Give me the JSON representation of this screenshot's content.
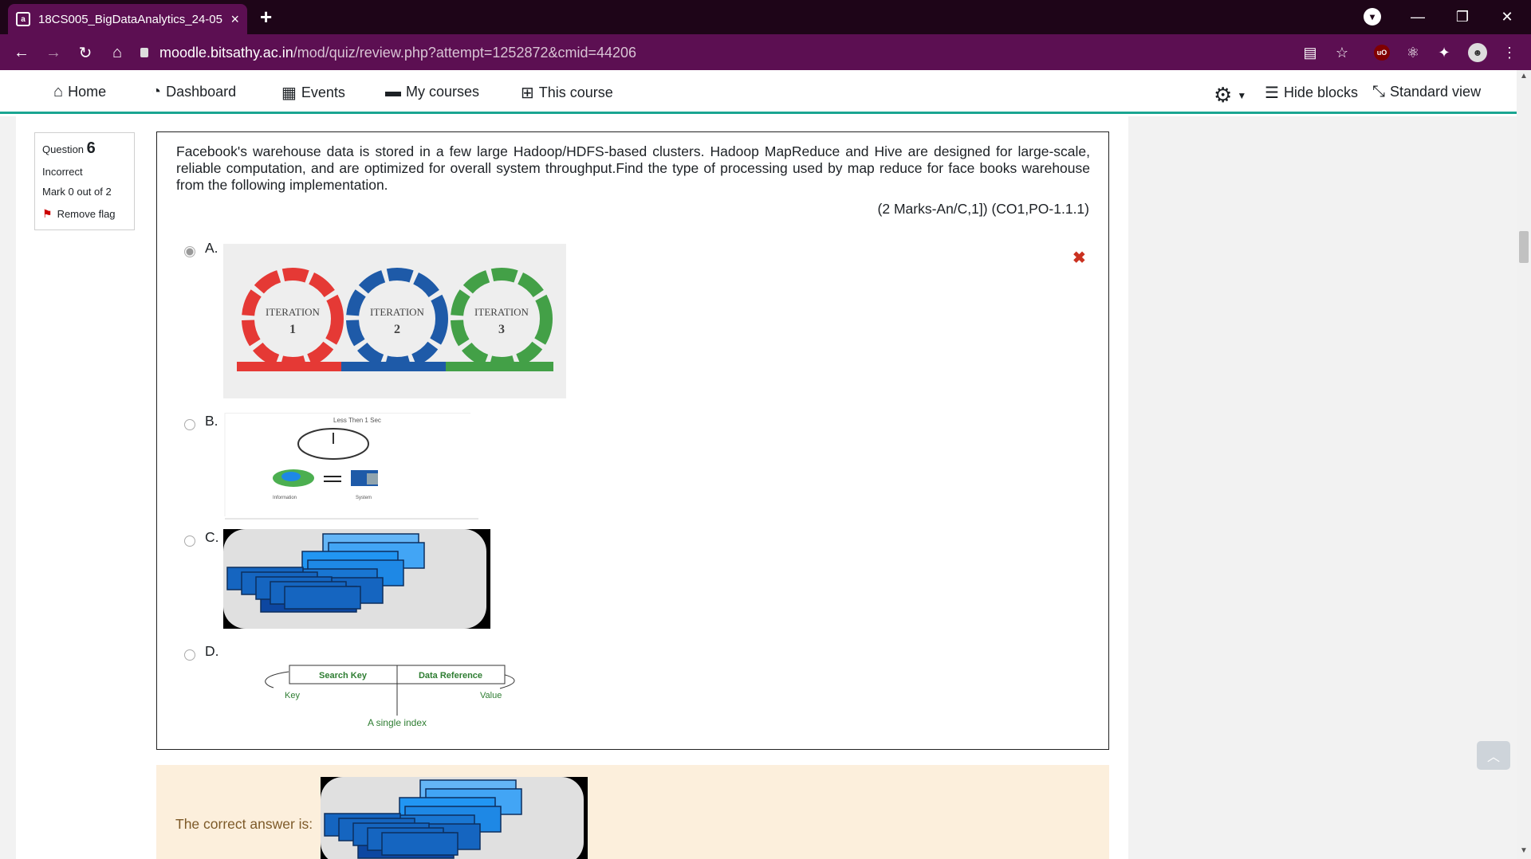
{
  "browser": {
    "tab_title": "18CS005_BigDataAnalytics_24-05",
    "tab_close": "×",
    "new_tab": "+",
    "url_host": "moodle.bitsathy.ac.in",
    "url_path": "/mod/quiz/review.php?attempt=1252872&cmid=44206",
    "ublock_label": "uO"
  },
  "nav": {
    "home": "Home",
    "dashboard": "Dashboard",
    "events": "Events",
    "my_courses": "My courses",
    "this_course": "This course",
    "hide_blocks": "Hide blocks",
    "standard_view": "Standard view"
  },
  "question_info": {
    "label": "Question",
    "number": "6",
    "state": "Incorrect",
    "mark": "Mark 0 out of 2",
    "flag": "Remove flag"
  },
  "question": {
    "text": "Facebook's warehouse data is stored in a few large Hadoop/HDFS-based clusters. Hadoop MapReduce and Hive are designed for large-scale, reliable computation, and are optimized for overall system throughput.Find the type of processing used by map reduce for face books warehouse from the following implementation.",
    "marks": "(2 Marks-An/C,1]) (CO1,PO-1.1.1)",
    "options": [
      {
        "label": "A.",
        "selected": true
      },
      {
        "label": "B.",
        "selected": false
      },
      {
        "label": "C.",
        "selected": false
      },
      {
        "label": "D.",
        "selected": false
      }
    ],
    "result_icon": "✖"
  },
  "option_a_image": {
    "iterations": [
      {
        "title": "ITERATION",
        "num": "1",
        "color": "#e53935"
      },
      {
        "title": "ITERATION",
        "num": "2",
        "color": "#1e5aa8"
      },
      {
        "title": "ITERATION",
        "num": "3",
        "color": "#43a047"
      }
    ]
  },
  "option_b_image": {
    "caption": "Less Then 1 Sec",
    "left_label": "Information",
    "right_label": "System"
  },
  "option_d_image": {
    "search_key": "Search Key",
    "data_reference": "Data Reference",
    "key": "Key",
    "value": "Value",
    "caption": "A single index"
  },
  "feedback": {
    "text": "The correct answer is:"
  }
}
